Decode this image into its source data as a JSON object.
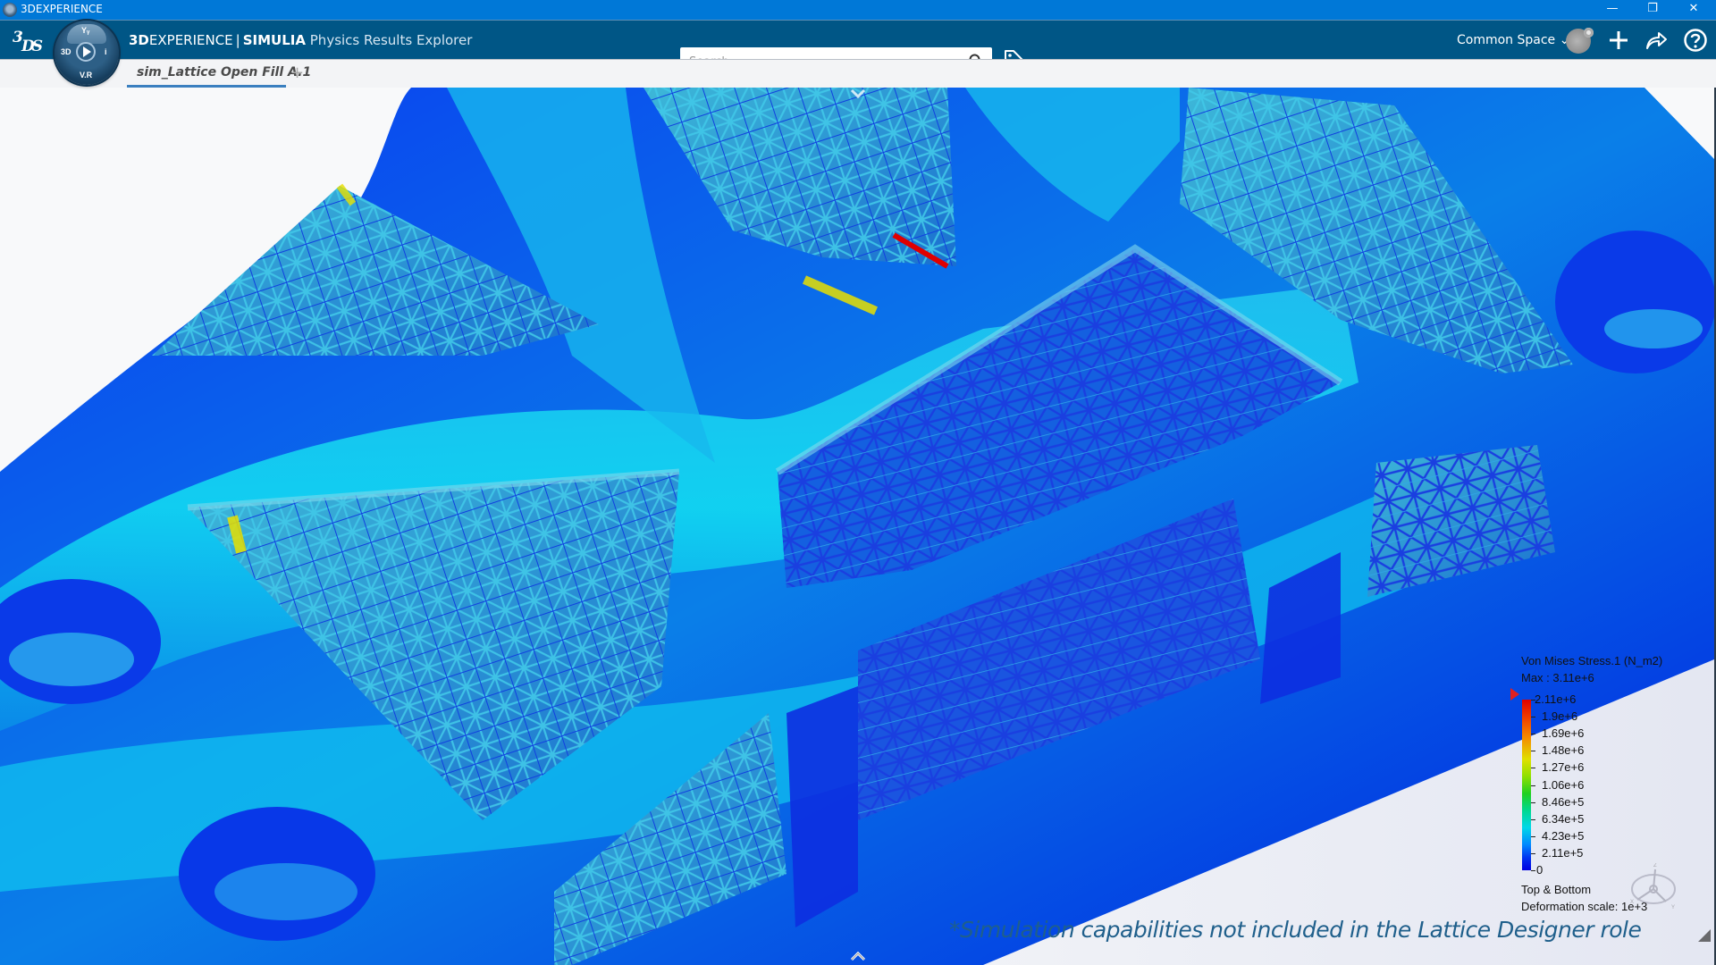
{
  "window": {
    "title": "3DEXPERIENCE",
    "controls": {
      "minimize": "—",
      "restore": "❐",
      "close": "✕"
    }
  },
  "header": {
    "logo": "3DS",
    "compass": {
      "top": "Yᵧ",
      "left": "3D",
      "right": "i",
      "bottom": "V.R"
    },
    "brand_bold": "3D",
    "brand_thin": "EXPERIENCE",
    "brand_sep": "|",
    "brand_product": "SIMULIA",
    "app_name": "Physics Results Explorer",
    "search_placeholder": "Search",
    "search_value": "",
    "space_label": "Common Space",
    "icons": [
      "search-icon",
      "tag-icon",
      "avatar",
      "add-icon",
      "share-icon",
      "help-icon"
    ]
  },
  "tabs": [
    {
      "label": "sim_Lattice Open Fill A.1",
      "active": true
    }
  ],
  "tab_add": "+",
  "viewport": {
    "legend": {
      "title": "Von Mises Stress.1 (N_m2)",
      "max": "Max : 3.11e+6",
      "ticks": [
        "2.11e+6",
        "1.9e+6",
        "1.69e+6",
        "1.48e+6",
        "1.27e+6",
        "1.06e+6",
        "8.46e+5",
        "6.34e+5",
        "4.23e+5",
        "2.11e+5",
        "0"
      ],
      "colors": {
        "high": "#e00000",
        "mid": "#20d020",
        "low": "#0000e0"
      },
      "display_mode": "Top & Bottom",
      "deformation_scale": "Deformation scale: 1e+3"
    },
    "triad_axes": [
      "Z",
      "X",
      "Y"
    ],
    "note": "*Simulation capabilities not included in the Lattice Designer role"
  },
  "colors": {
    "titlebar": "#0078d7",
    "header": "#005686",
    "tab_underline": "#3a7fbf",
    "note": "#1f5f8b"
  }
}
